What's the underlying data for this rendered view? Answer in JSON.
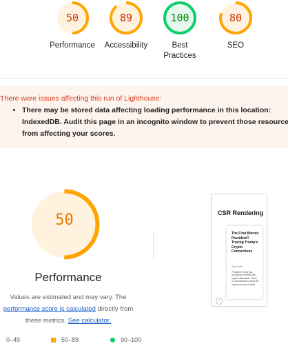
{
  "scores": [
    {
      "label": "Performance",
      "value": "50",
      "score": 50,
      "color": "#ffa400",
      "bg": "#fff3e0",
      "text_color": "#c33300"
    },
    {
      "label": "Accessibility",
      "value": "89",
      "score": 89,
      "color": "#ffa400",
      "bg": "#fff3e0",
      "text_color": "#c33300"
    },
    {
      "label": "Best Practices",
      "value": "100",
      "score": 100,
      "color": "#0cce6b",
      "bg": "#e6f8ee",
      "text_color": "#008800"
    },
    {
      "label": "SEO",
      "value": "80",
      "score": 80,
      "color": "#ffa400",
      "bg": "#fff3e0",
      "text_color": "#c33300"
    }
  ],
  "warning": {
    "title": "There were issues affecting this run of Lighthouse:",
    "items": [
      "There may be stored data affecting loading performance in this location: IndexedDB. Audit this page in an incognito window to prevent those resources from affecting your scores."
    ]
  },
  "performance": {
    "score": "50",
    "score_value": 50,
    "title": "Performance",
    "desc_prefix": "Values are estimated and may vary. The ",
    "desc_link1": "performance score is calculated",
    "desc_mid": " directly from these metrics. ",
    "desc_link2": "See calculator."
  },
  "legend": [
    {
      "range": "0–49",
      "shape": "triangle",
      "color": "#ff4e42"
    },
    {
      "range": "50–89",
      "shape": "square",
      "color": "#ffa400"
    },
    {
      "range": "90–100",
      "shape": "circle",
      "color": "#0cce6b"
    }
  ],
  "thumbnail": {
    "heading": "CSR Rendering",
    "card_title": "The First Bitcoin President? Tracing Trump's Crypto Connections",
    "card_author": "Jack Smith",
    "card_body": "President Trump has surrounded himself with crypto enthusiasts. There no connections in 2024 the cryptocurrency industry",
    "button_icon": "arrow-icon"
  }
}
